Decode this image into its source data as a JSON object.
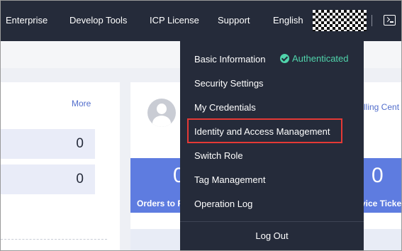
{
  "nav": {
    "items": [
      "Enterprise",
      "Develop Tools",
      "ICP License",
      "Support",
      "English"
    ]
  },
  "left_card": {
    "more_label": "More",
    "stats": [
      "0",
      "0"
    ]
  },
  "right_card": {
    "billing_link": "lling Cent",
    "tiles": [
      {
        "number": "0",
        "label": "Orders to P"
      },
      {
        "number": "0",
        "label": "vice Ticke"
      }
    ]
  },
  "dropdown": {
    "basic_info": "Basic Information",
    "status": "Authenticated",
    "items": [
      "Security Settings",
      "My Credentials",
      "Identity and Access Management",
      "Switch Role",
      "Tag Management",
      "Operation Log"
    ],
    "logout": "Log Out"
  },
  "colors": {
    "topbar": "#252b3a",
    "accent": "#5e7ce0",
    "authenticated": "#50d4ab",
    "highlight": "#e53935"
  },
  "icons": [
    "check-circle-icon",
    "console-icon",
    "user-avatar-icon"
  ]
}
